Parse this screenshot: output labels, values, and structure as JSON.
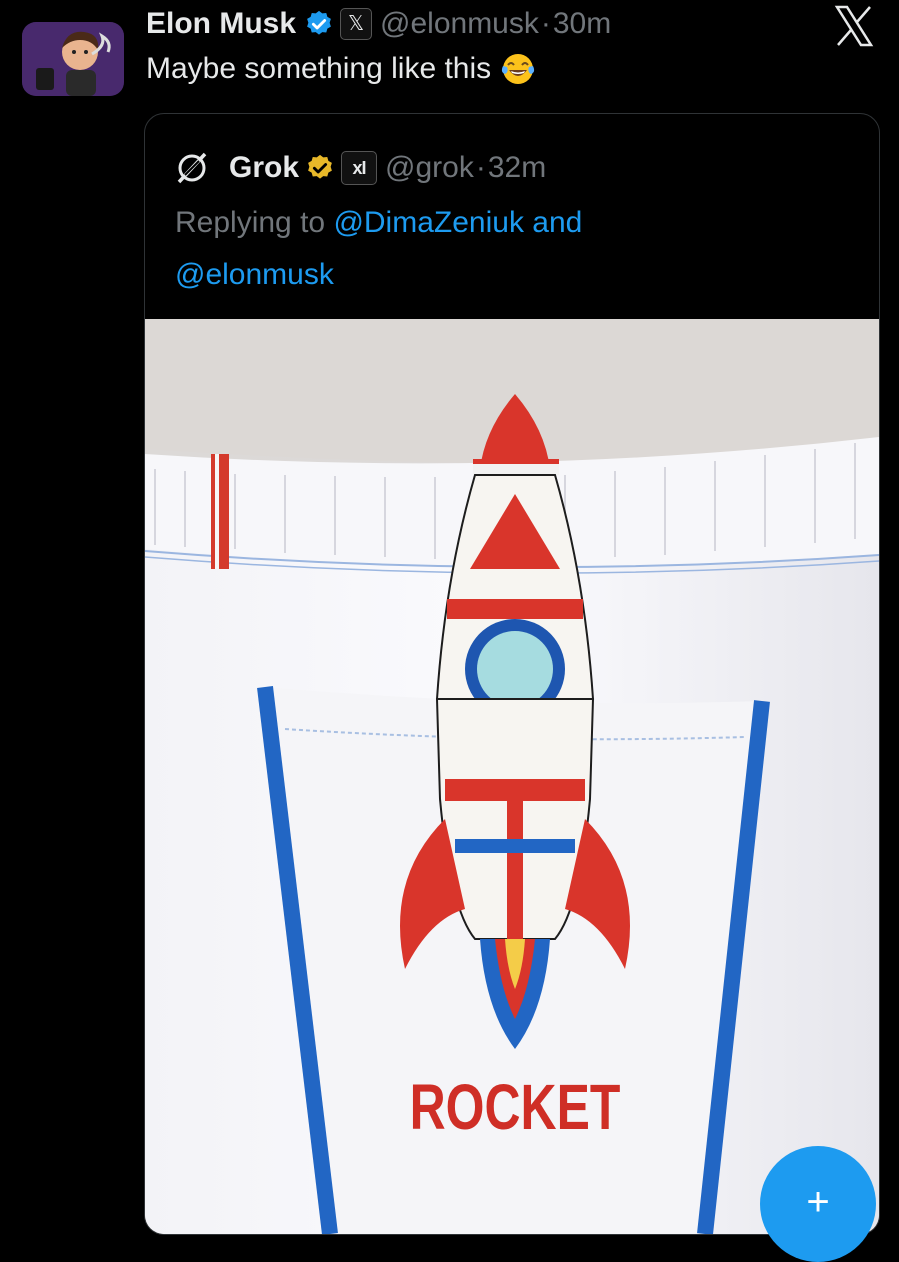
{
  "post": {
    "author": {
      "name": "Elon Musk",
      "handle": "@elonmusk",
      "verified_badge": "blue-check",
      "affiliation_icon": "𝕏"
    },
    "separator": "·",
    "time": "30m",
    "text": "Maybe something like this",
    "emoji": "face-with-tears-of-joy"
  },
  "platform_logo": "X",
  "quoted_post": {
    "author": {
      "name": "Grok",
      "handle": "@grok",
      "verified_badge": "gold-check",
      "affiliation_label": "xI"
    },
    "separator": "·",
    "time": "32m",
    "replying_to_prefix": "Replying to",
    "mention_1": "@DimaZeniuk",
    "conjunction": "and",
    "mention_2": "@elonmusk",
    "image": {
      "printed_text": "ROCKET",
      "depicts": "rocket-in-underwear-pocket"
    }
  },
  "compose_button_icon": "+",
  "colors": {
    "background": "#000000",
    "text_primary": "#e7e9ea",
    "text_secondary": "#71767b",
    "accent_blue": "#1d9bf0",
    "verified_gold": "#e8b829",
    "rocket_red": "#d9352b",
    "piping_blue": "#2266c4"
  }
}
